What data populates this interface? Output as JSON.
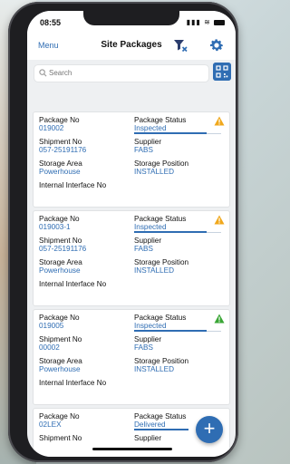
{
  "statusbar": {
    "time": "08:55"
  },
  "navbar": {
    "menu_label": "Menu",
    "title": "Site Packages"
  },
  "search": {
    "placeholder": "Search"
  },
  "packages": [
    {
      "package_no": "019002",
      "status": "Inspected",
      "shipment_no": "057-25191176",
      "supplier": "FABS",
      "storage_area": "Powerhouse",
      "storage_position": "INSTALLED",
      "alert": "warning"
    },
    {
      "package_no": "019003-1",
      "status": "Inspected",
      "shipment_no": "057-25191176",
      "supplier": "FABS",
      "storage_area": "Powerhouse",
      "storage_position": "INSTALLED",
      "alert": "warning"
    },
    {
      "package_no": "019005",
      "status": "Inspected",
      "shipment_no": "00002",
      "supplier": "FABS",
      "storage_area": "Powerhouse",
      "storage_position": "INSTALLED",
      "alert": "ok"
    },
    {
      "package_no": "02LEX",
      "status": "Delivered",
      "shipment_no": "",
      "supplier": "",
      "storage_area": "",
      "storage_position": "",
      "alert": "none"
    }
  ],
  "labels": {
    "package_no": "Package No",
    "package_status": "Package Status",
    "shipment_no": "Shipment No",
    "supplier": "Supplier",
    "storage_area": "Storage Area",
    "storage_position": "Storage Position",
    "internal_interface": "Internal Interface No"
  },
  "colors": {
    "accent": "#2f6db3",
    "warning": "#f0a81c",
    "ok": "#3aa635"
  },
  "fab": {
    "label": "+"
  }
}
